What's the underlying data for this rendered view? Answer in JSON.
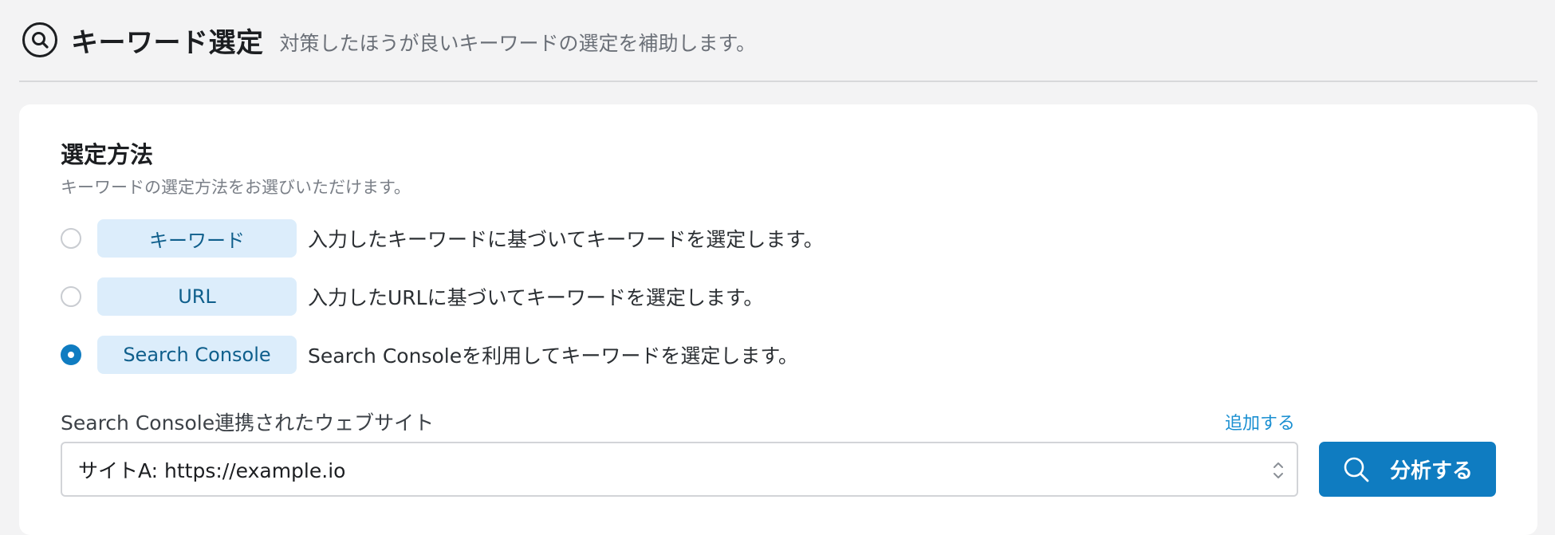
{
  "header": {
    "title": "キーワード選定",
    "subtitle": "対策したほうが良いキーワードの選定を補助します。",
    "icon": "search-circle-icon"
  },
  "method_section": {
    "title": "選定方法",
    "description": "キーワードの選定方法をお選びいただけます。",
    "options": [
      {
        "label": "キーワード",
        "description": "入力したキーワードに基づいてキーワードを選定します。",
        "selected": false
      },
      {
        "label": "URL",
        "description": "入力したURLに基づいてキーワードを選定します。",
        "selected": false
      },
      {
        "label": "Search Console",
        "description": "Search Consoleを利用してキーワードを選定します。",
        "selected": true
      }
    ]
  },
  "site_section": {
    "label": "Search Console連携されたウェブサイト",
    "add_link": "追加する",
    "selected_site": "サイトA: https://example.io",
    "chevron_icon": "updown-chevron-icon"
  },
  "analyze_button": {
    "label": "分析する",
    "icon": "search-icon"
  },
  "colors": {
    "accent": "#0f7cc1",
    "chip_bg": "#dcedfb",
    "chip_text": "#0f5f8c",
    "link": "#1a8fd1",
    "page_bg": "#f3f3f4"
  }
}
